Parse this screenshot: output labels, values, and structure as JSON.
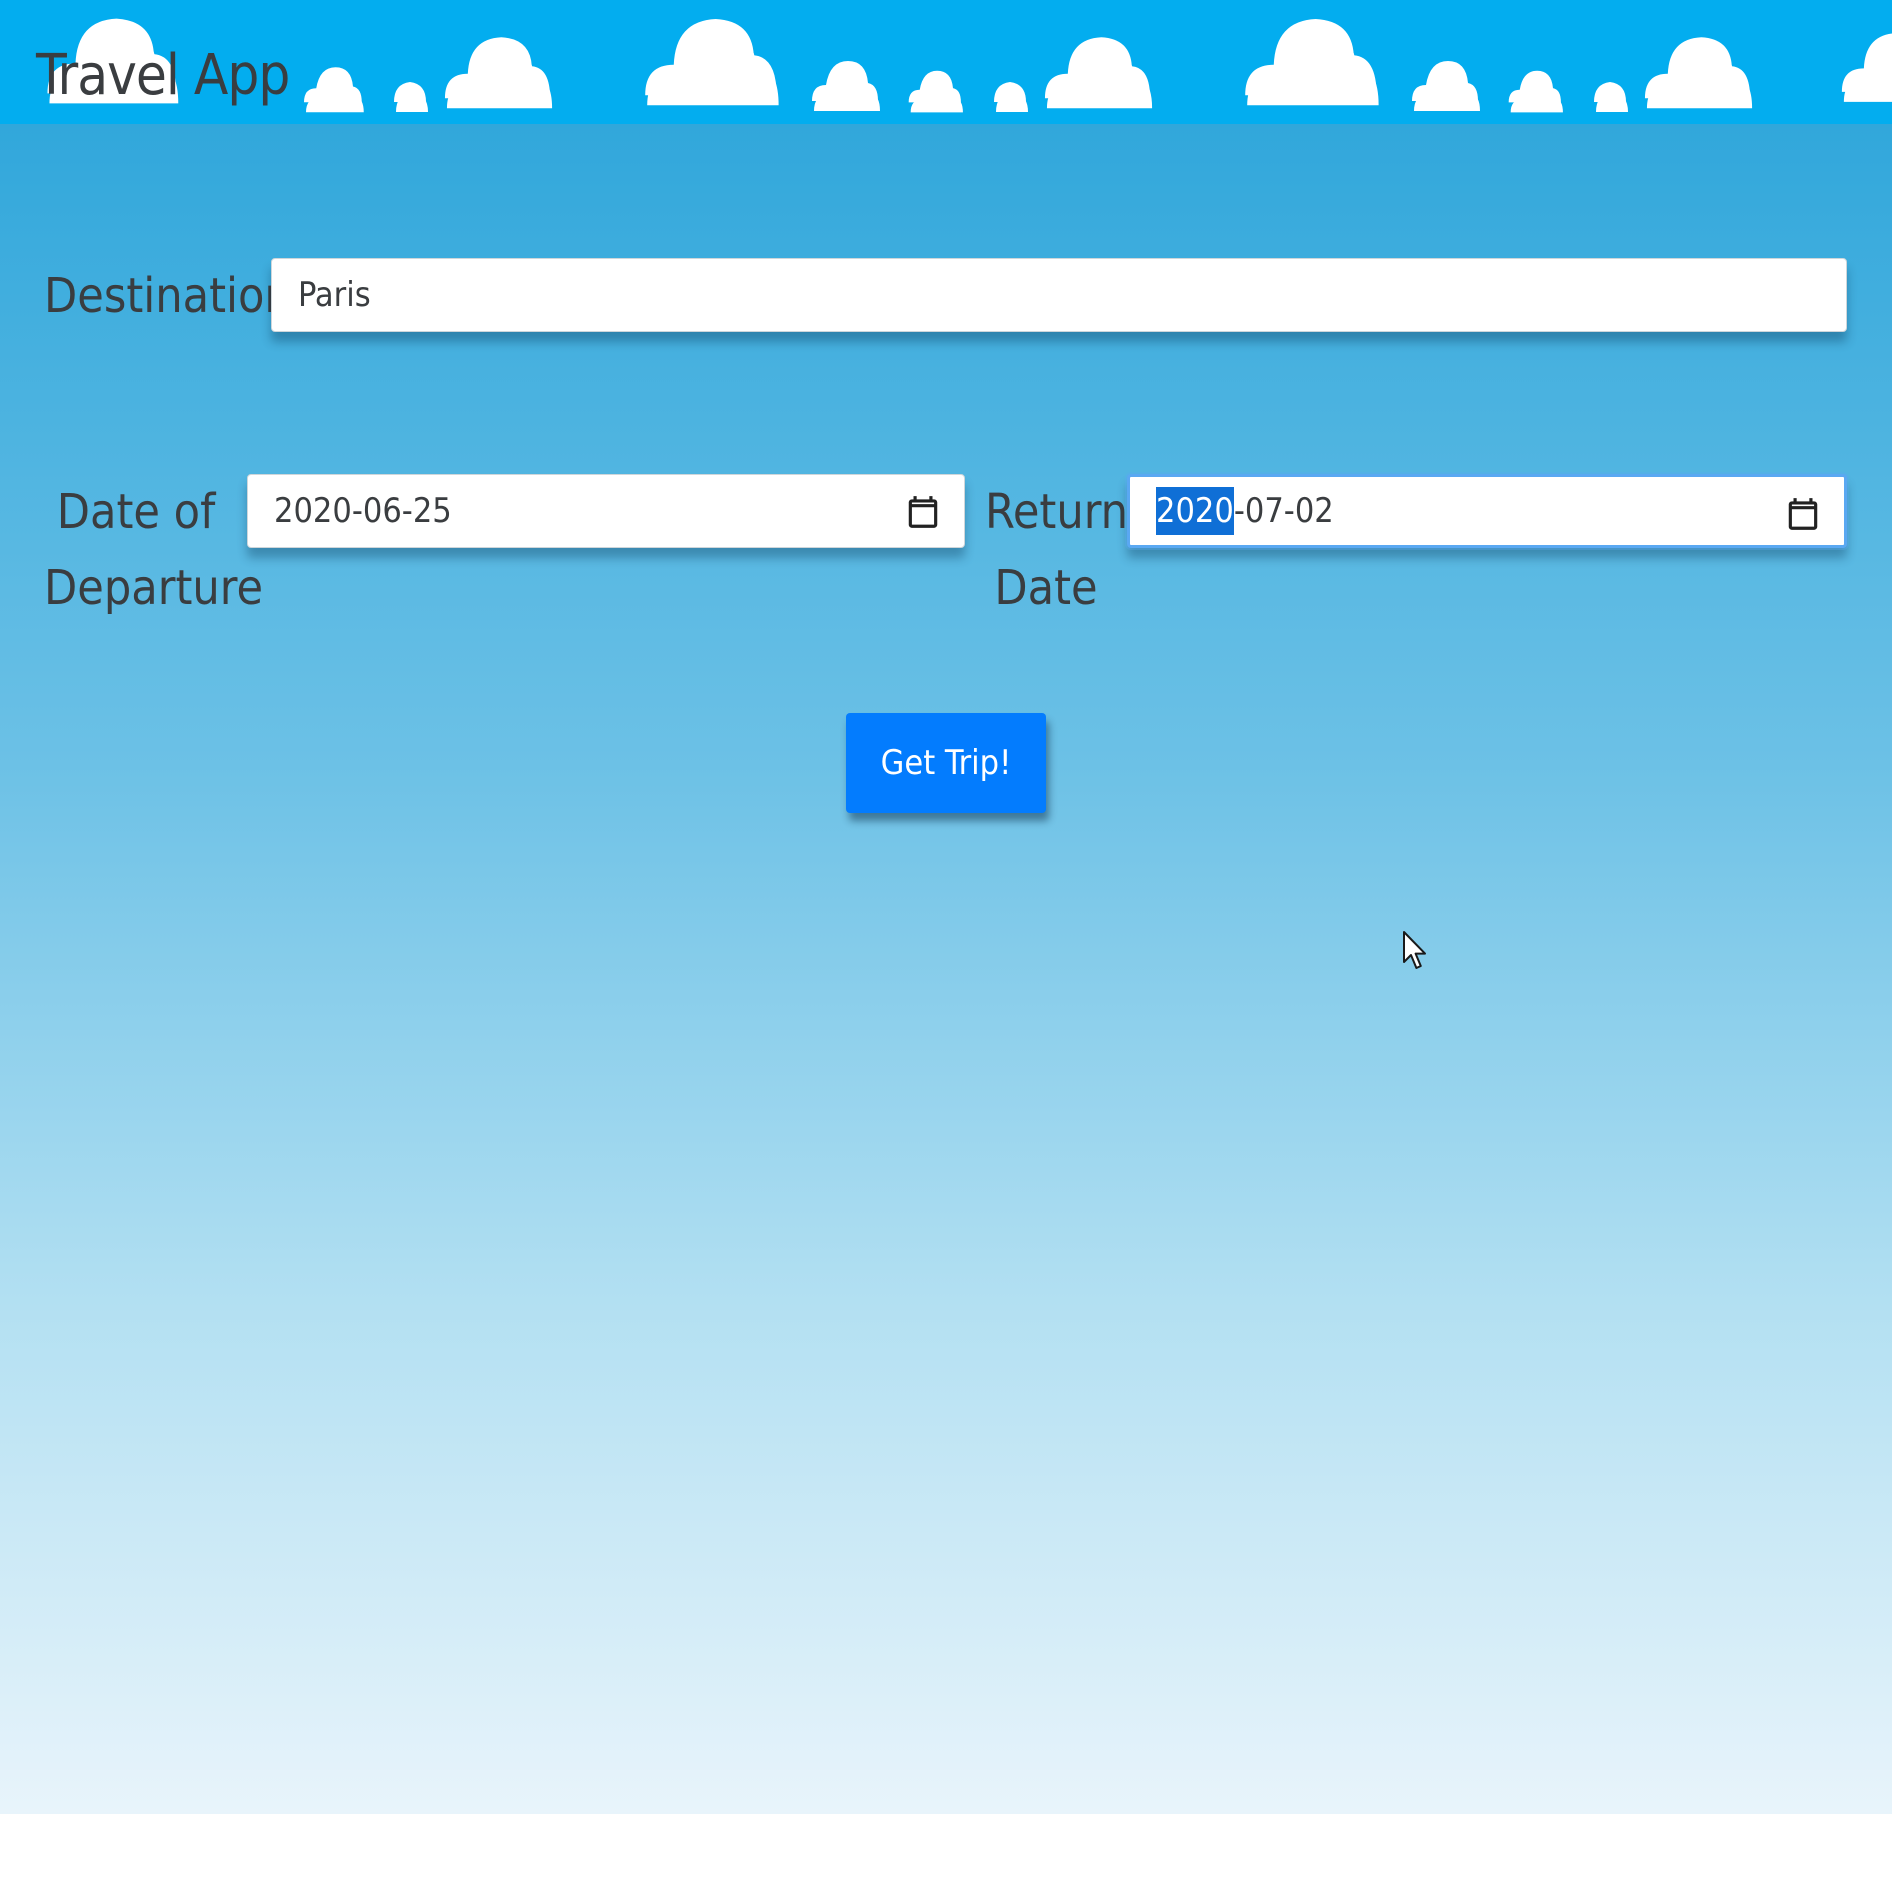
{
  "header": {
    "title": "Travel App",
    "background_color": "#03adef"
  },
  "form": {
    "destination": {
      "label": "Destination",
      "value": "Paris"
    },
    "departure": {
      "label_line1": "Date of",
      "label_line2": "Departure",
      "value": "2020-06-25",
      "icon": "calendar-icon"
    },
    "return": {
      "label_line1": "Return",
      "label_line2": "Date",
      "value_selected_segment": "2020",
      "value_rest": "-07-02",
      "icon": "calendar-icon",
      "focused": true
    },
    "submit": {
      "label": "Get Trip!",
      "color": "#037cfe"
    }
  },
  "decor": {
    "cloud_icon": "cloud-icon",
    "pointer_icon": "mouse-pointer-icon"
  }
}
